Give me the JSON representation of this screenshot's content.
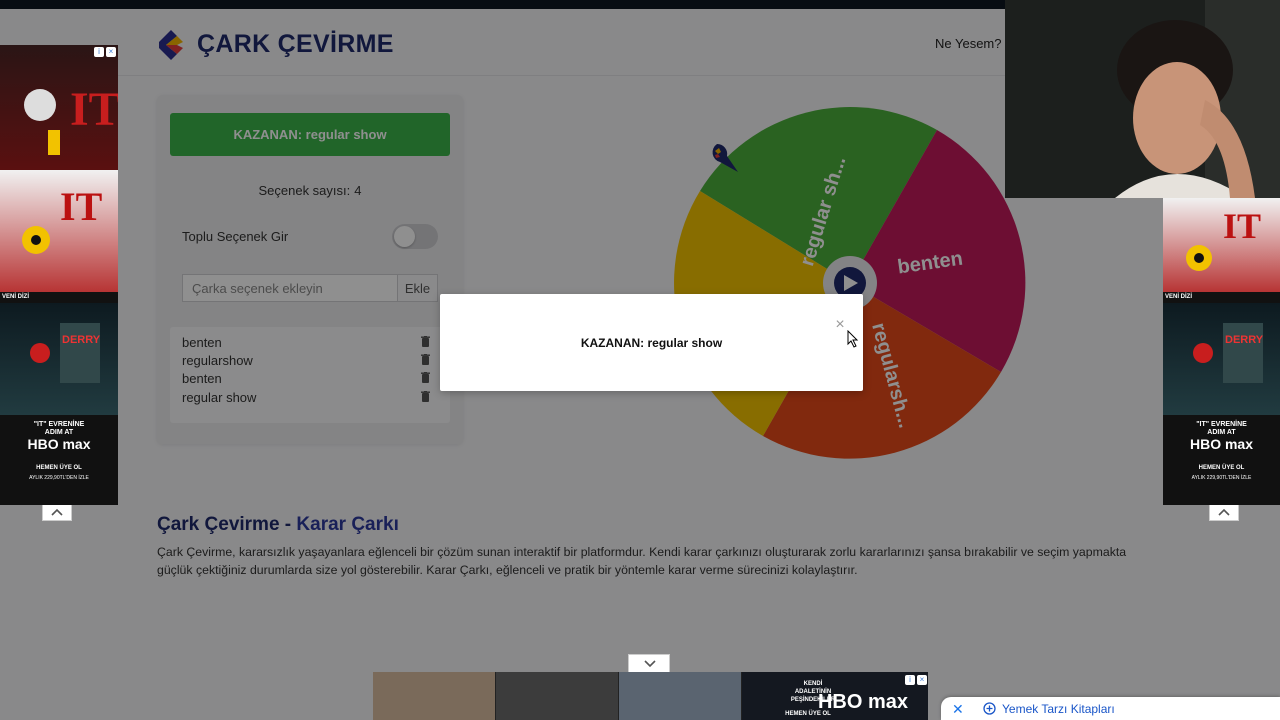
{
  "header": {
    "title": "ÇARK ÇEVİRME",
    "nav_link": "Ne Yesem?"
  },
  "panel": {
    "winner_button": "KAZANAN: regular show",
    "count_label": "Seçenek sayısı:",
    "count_value": "4",
    "bulk_label": "Toplu Seçenek Gir",
    "bulk_toggle_on": false,
    "add_placeholder": "Çarka seçenek ekleyin",
    "add_button": "Ekle",
    "options": [
      "benten",
      "regularshow",
      "benten",
      "regular show"
    ]
  },
  "wheel": {
    "segments": [
      {
        "label": "regular sh...",
        "color": "#4caf3c"
      },
      {
        "label": "benten",
        "color": "#c2195b"
      },
      {
        "label": "regularsh...",
        "color": "#e64a19"
      },
      {
        "label": "benten",
        "color": "#f2c200"
      }
    ]
  },
  "modal": {
    "text": "KAZANAN: regular show",
    "close": "×"
  },
  "content": {
    "title_part1": "Çark Çevirme - ",
    "title_part2": "Karar Çarkı",
    "paragraph": "Çark Çevirme, kararsızlık yaşayanlara eğlenceli bir çözüm sunan interaktif bir platformdur. Kendi karar çarkınızı oluşturarak zorlu kararlarınızı şansa bırakabilir ve seçim yapmakta güçlük çektiğiniz durumlarda size yol gösterebilir. Karar Çarkı, eğlenceli ve pratik bir yöntemle karar verme sürecinizi kolaylaştırır."
  },
  "ads": {
    "veni_dizi": "VENİ DİZİ",
    "ad_line1": "\"IT\" EVRENİNE",
    "ad_line2": "ADIM AT",
    "brand": "HBO max",
    "cta": "HEMEN ÜYE OL",
    "price": "AYLIK 229,90TL'DEN İZLE",
    "bottom_line1": "KENDİ",
    "bottom_line2": "ADALETİNİN",
    "bottom_line3": "PEŞİNDEKİLER",
    "bottom_cta": "HEMEN ÜYE OL"
  },
  "suggestion": {
    "text": "Yemek Tarzı Kitapları"
  }
}
